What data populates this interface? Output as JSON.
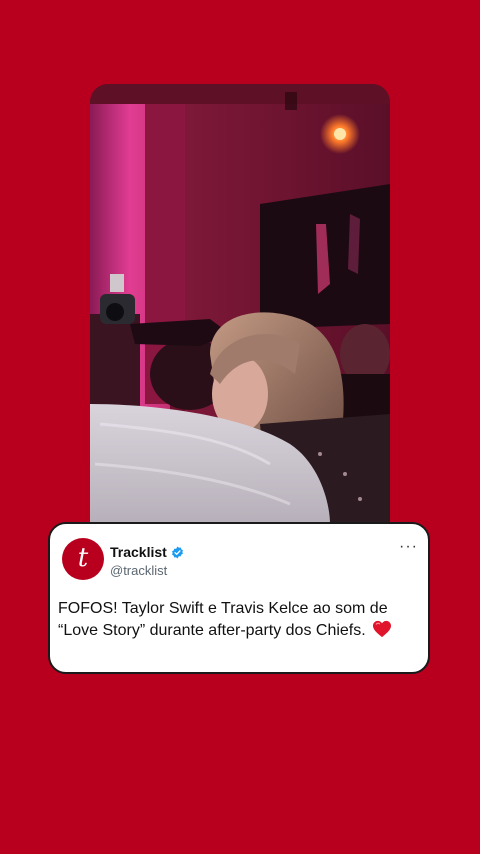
{
  "photo": {
    "icon": "party-photo"
  },
  "tweet": {
    "avatar_letter": "t",
    "display_name": "Tracklist",
    "handle": "@tracklist",
    "verified_icon": "verified-badge-icon",
    "more_label": "···",
    "text": "FOFOS! Taylor Swift e Travis Kelce ao som de “Love Story” durante after-party dos Chiefs.",
    "emoji": "red-heart-icon"
  },
  "colors": {
    "background": "#b8001e",
    "card": "#ffffff",
    "verified": "#1d9bf0"
  }
}
